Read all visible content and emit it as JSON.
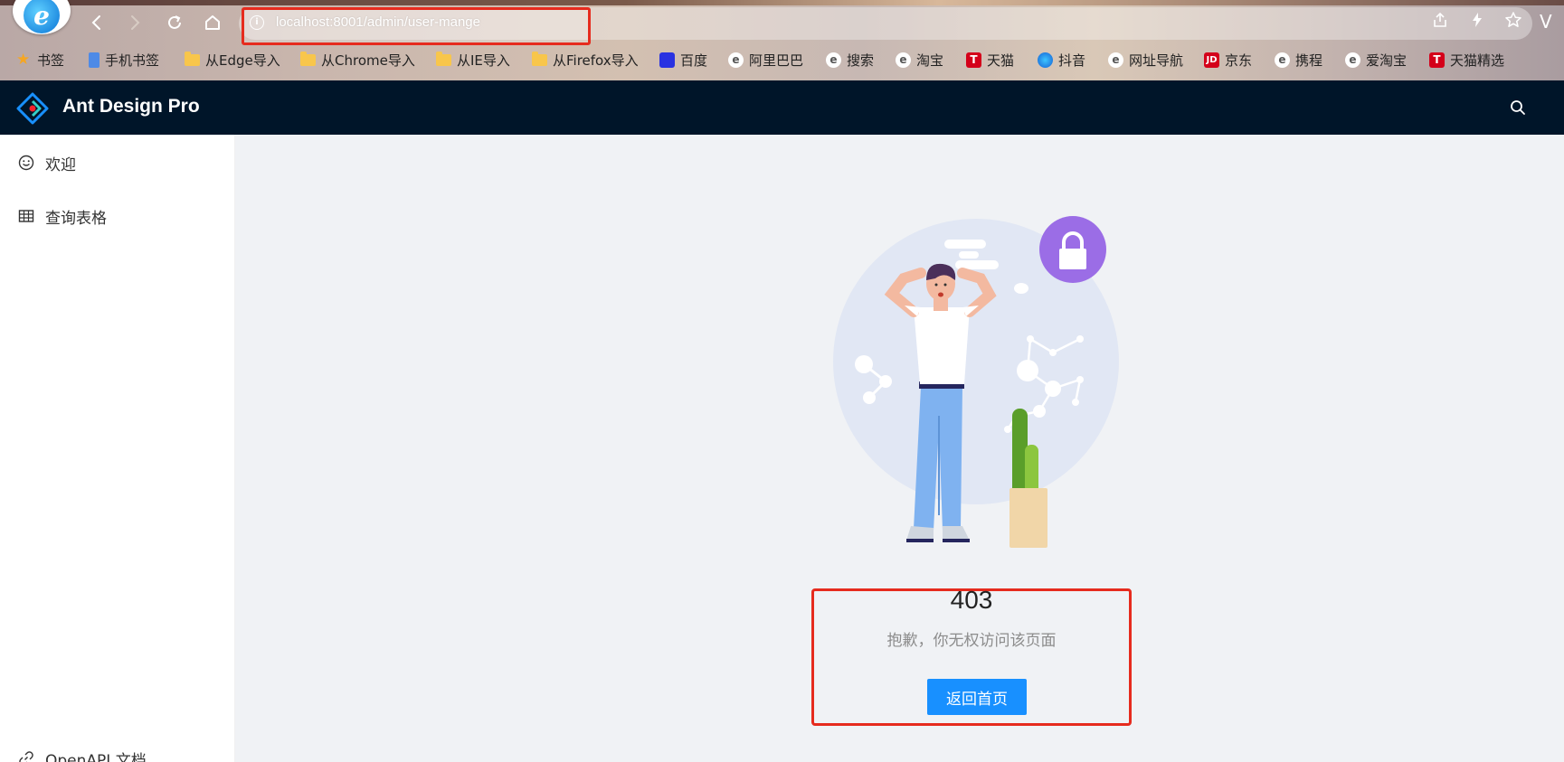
{
  "browser": {
    "url": "localhost:8001/admin/user-mange",
    "bookmarks": [
      {
        "label": "书签",
        "icon": "star-icon"
      },
      {
        "label": "手机书签",
        "icon": "phone-icon"
      },
      {
        "label": "从Edge导入",
        "icon": "folder-icon"
      },
      {
        "label": "从Chrome导入",
        "icon": "folder-icon"
      },
      {
        "label": "从IE导入",
        "icon": "folder-icon"
      },
      {
        "label": "从Firefox导入",
        "icon": "folder-icon"
      },
      {
        "label": "百度",
        "icon": "baidu-icon"
      },
      {
        "label": "阿里巴巴",
        "icon": "browser-e-icon"
      },
      {
        "label": "搜索",
        "icon": "browser-e-icon"
      },
      {
        "label": "淘宝",
        "icon": "browser-e-icon"
      },
      {
        "label": "天猫",
        "icon": "tmall-icon"
      },
      {
        "label": "抖音",
        "icon": "douyin-icon"
      },
      {
        "label": "网址导航",
        "icon": "browser-e-icon"
      },
      {
        "label": "京东",
        "icon": "jd-icon"
      },
      {
        "label": "携程",
        "icon": "browser-e-icon"
      },
      {
        "label": "爱淘宝",
        "icon": "browser-e-icon"
      },
      {
        "label": "天猫精选",
        "icon": "tmall-icon"
      }
    ]
  },
  "header": {
    "title": "Ant Design Pro"
  },
  "sidebar": {
    "items": [
      {
        "label": "欢迎",
        "icon": "smile-icon"
      },
      {
        "label": "查询表格",
        "icon": "table-icon"
      },
      {
        "label": "OpenAPI 文档",
        "icon": "link-icon"
      }
    ]
  },
  "result": {
    "status": "403",
    "subtitle": "抱歉，你无权访问该页面",
    "button_label": "返回首页"
  },
  "colors": {
    "header_bg": "#001529",
    "primary": "#1890ff",
    "highlight": "#e62b1e",
    "content_bg": "#f0f2f5"
  }
}
